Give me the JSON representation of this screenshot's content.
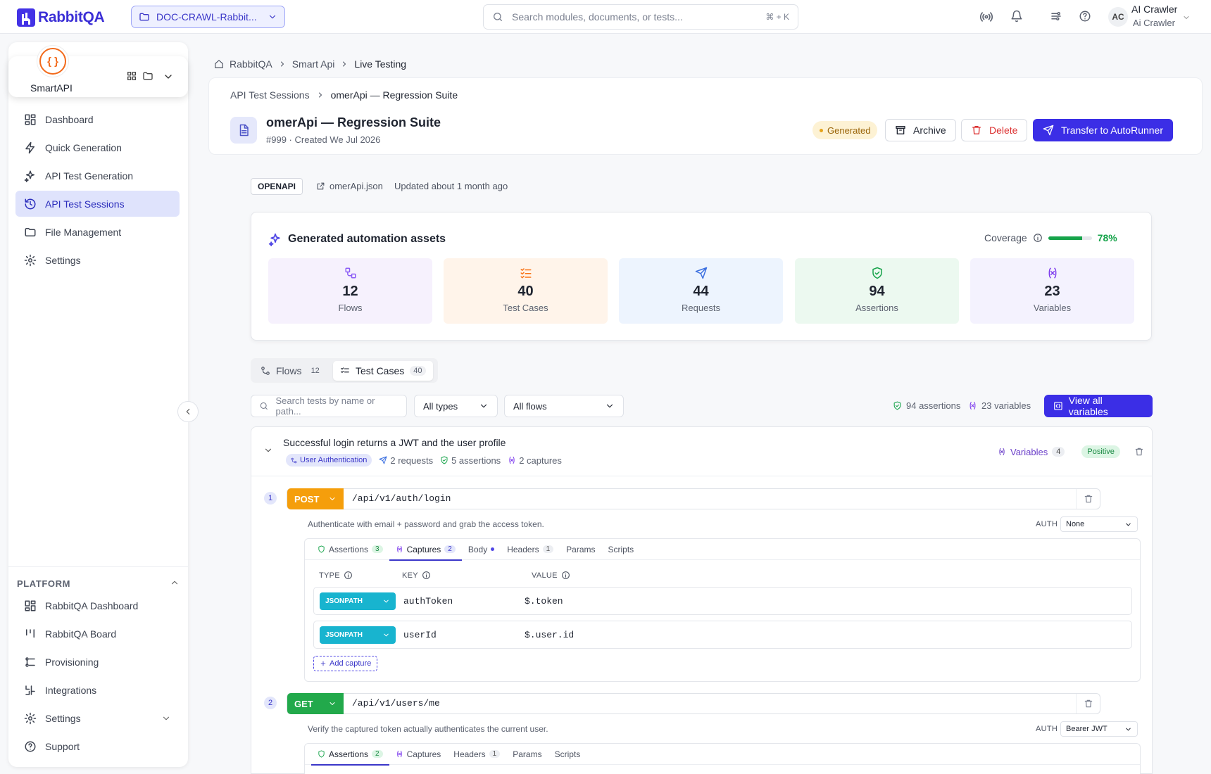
{
  "topbar": {
    "brand": "RabbitQA",
    "project": "DOC-CRAWL-Rabbit...",
    "search_placeholder": "Search modules, documents, or tests...",
    "search_shortcut": "⌘ + K",
    "user_initials": "AC",
    "user_name": "AI Crawler",
    "user_sub": "Ai Crawler"
  },
  "sidebar": {
    "module": "SmartAPI",
    "module_glyph": "{ }",
    "nav": [
      {
        "label": "Dashboard",
        "icon": "dashboard-icon"
      },
      {
        "label": "Quick Generation",
        "icon": "bolt-icon"
      },
      {
        "label": "API Test Generation",
        "icon": "sparkles-icon"
      },
      {
        "label": "API Test Sessions",
        "icon": "history-icon",
        "active": true
      },
      {
        "label": "File Management",
        "icon": "folder-icon"
      },
      {
        "label": "Settings",
        "icon": "gear-icon"
      }
    ],
    "platform_title": "PLATFORM",
    "platform": [
      {
        "label": "RabbitQA Dashboard",
        "icon": "dashboard-icon"
      },
      {
        "label": "RabbitQA Board",
        "icon": "board-icon"
      },
      {
        "label": "Provisioning",
        "icon": "provisioning-icon"
      },
      {
        "label": "Integrations",
        "icon": "integrations-icon"
      },
      {
        "label": "Settings",
        "icon": "gear-icon"
      },
      {
        "label": "Support",
        "icon": "help-icon"
      }
    ]
  },
  "breadcrumb": [
    "RabbitQA",
    "Smart Api",
    "Live Testing"
  ],
  "header": {
    "subcrumb": [
      "API Test Sessions",
      "omerApi — Regression Suite"
    ],
    "title": "omerApi — Regression Suite",
    "subtitle": "#999 · Created We Jul 2026",
    "status": "Generated",
    "archive": "Archive",
    "delete": "Delete",
    "transfer": "Transfer to AutoRunner"
  },
  "meta": {
    "spec_type": "OPENAPI",
    "file": "omerApi.json",
    "updated": "Updated about 1 month ago"
  },
  "assets": {
    "title": "Generated automation assets",
    "coverage_label": "Coverage",
    "coverage_pct": "78%",
    "coverage_value": 0.78,
    "stats": [
      {
        "value": "12",
        "label": "Flows",
        "bg": "#f6f1fd",
        "color": "#8b5cf6"
      },
      {
        "value": "40",
        "label": "Test Cases",
        "bg": "#fff4ea",
        "color": "#f97316"
      },
      {
        "value": "44",
        "label": "Requests",
        "bg": "#edf4fe",
        "color": "#3b6fe0"
      },
      {
        "value": "94",
        "label": "Assertions",
        "bg": "#ecf9f0",
        "color": "#16a34a"
      },
      {
        "value": "23",
        "label": "Variables",
        "bg": "#f4f2fe",
        "color": "#7c3aed"
      }
    ]
  },
  "tabs": {
    "flows": "Flows",
    "flows_count": "12",
    "cases": "Test Cases",
    "cases_count": "40"
  },
  "filters": {
    "search_placeholder": "Search tests by name or path...",
    "type": "All types",
    "flow": "All flows",
    "assertions": "94 assertions",
    "variables": "23 variables",
    "view_all": "View all variables"
  },
  "testcase": {
    "title": "Successful login returns a JWT and the user profile",
    "flow": "User Authentication",
    "requests": "2 requests",
    "assertions": "5 assertions",
    "captures": "2 captures",
    "variables_label": "Variables",
    "variables_count": "4",
    "type": "Positive",
    "steps": [
      {
        "n": "1",
        "method": "POST",
        "color": "#f59e0b",
        "path": "/api/v1/auth/login",
        "desc": "Authenticate with email + password and grab the access token.",
        "auth_label": "AUTH",
        "auth": "None",
        "tabs": [
          "Assertions",
          "Captures",
          "Body",
          "Headers",
          "Params",
          "Scripts"
        ],
        "counts": {
          "Assertions": "3",
          "Captures": "2",
          "Headers": "1"
        },
        "columns": [
          "TYPE",
          "KEY",
          "VALUE"
        ],
        "captures_rows": [
          {
            "type": "JSONPATH",
            "key": "authToken",
            "value": "$.token"
          },
          {
            "type": "JSONPATH",
            "key": "userId",
            "value": "$.user.id"
          }
        ],
        "add_capture": "Add capture"
      },
      {
        "n": "2",
        "method": "GET",
        "color": "#22a94b",
        "path": "/api/v1/users/me",
        "desc": "Verify the captured token actually authenticates the current user.",
        "auth_label": "AUTH",
        "auth": "Bearer JWT",
        "tabs": [
          "Assertions",
          "Captures",
          "Headers",
          "Params",
          "Scripts"
        ],
        "counts": {
          "Assertions": "2",
          "Headers": "1"
        }
      }
    ]
  }
}
